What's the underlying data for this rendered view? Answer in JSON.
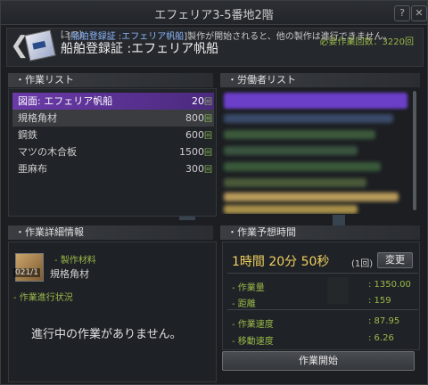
{
  "window": {
    "title": "エフェリア3-5番地2階"
  },
  "header": {
    "stage": "[3/3]",
    "recipe_title": "船舶登録証 :エフェリア帆船",
    "required_label": "必要作業回数：",
    "required_value": "3220回",
    "notice_prefix": "- [",
    "notice_item": "船舶登録証 :エフェリア帆船",
    "notice_suffix": "]製作が開始されると、他の製作は進行できません。"
  },
  "work_list": {
    "title": "・作業リスト",
    "items": [
      {
        "name": "図面: エフェリア帆船",
        "count": "20",
        "unit": "回"
      },
      {
        "name": "規格角材",
        "count": "800",
        "unit": "回"
      },
      {
        "name": "鋼鉄",
        "count": "600",
        "unit": "回"
      },
      {
        "name": "マツの木合板",
        "count": "1500",
        "unit": "回"
      },
      {
        "name": "亜麻布",
        "count": "300",
        "unit": "回"
      }
    ]
  },
  "worker_list": {
    "title": "・労働者リスト"
  },
  "detail": {
    "title": "・作業詳細情報",
    "material_label": "- 製作材料",
    "material_count": "021/1",
    "material_name": "規格角材",
    "progress_label": "- 作業進行状況",
    "empty_text": "進行中の作業がありません。"
  },
  "estimate": {
    "title": "・作業予想時間",
    "time": "1時間 20分 50秒",
    "times": "(1回)",
    "change_button": "変更",
    "stats": [
      {
        "label": "- 作業量",
        "value": ": 1350.00"
      },
      {
        "label": "- 距離",
        "value": ": 159"
      },
      {
        "label": "- 作業速度",
        "value": ": 87.95"
      },
      {
        "label": "- 移動速度",
        "value": ": 6.26"
      }
    ],
    "start_button": "作業開始"
  },
  "colors": {
    "accent": "#9ab84a",
    "selected": "#6a3aa8"
  }
}
